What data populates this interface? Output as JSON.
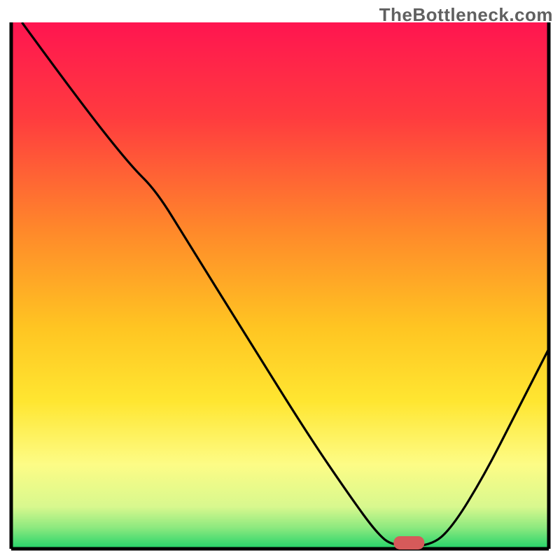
{
  "watermark": "TheBottleneck.com",
  "chart_data": {
    "type": "line",
    "title": "",
    "xlabel": "",
    "ylabel": "",
    "xlim": [
      0,
      100
    ],
    "ylim": [
      0,
      100
    ],
    "notes": "Gradient bottleneck heat chart with a black V-shaped curve; minimum between x≈70 and x≈78 (green zone). Red marker sits on the green band at the curve minimum.",
    "gradient_stops": [
      {
        "pct": 0,
        "color": "#ff1550"
      },
      {
        "pct": 18,
        "color": "#ff3b3f"
      },
      {
        "pct": 40,
        "color": "#ff8a2a"
      },
      {
        "pct": 58,
        "color": "#ffc522"
      },
      {
        "pct": 72,
        "color": "#ffe631"
      },
      {
        "pct": 84,
        "color": "#fdfc86"
      },
      {
        "pct": 92,
        "color": "#d8f88e"
      },
      {
        "pct": 96,
        "color": "#8ce97f"
      },
      {
        "pct": 100,
        "color": "#22d36a"
      }
    ],
    "curve_points": [
      {
        "x": 2,
        "y": 100
      },
      {
        "x": 12,
        "y": 86
      },
      {
        "x": 22,
        "y": 73
      },
      {
        "x": 27,
        "y": 68
      },
      {
        "x": 33,
        "y": 58
      },
      {
        "x": 44,
        "y": 40
      },
      {
        "x": 55,
        "y": 22
      },
      {
        "x": 63,
        "y": 10
      },
      {
        "x": 68,
        "y": 3
      },
      {
        "x": 71,
        "y": 0.5
      },
      {
        "x": 78,
        "y": 0.5
      },
      {
        "x": 82,
        "y": 4
      },
      {
        "x": 88,
        "y": 14
      },
      {
        "x": 94,
        "y": 26
      },
      {
        "x": 100,
        "y": 38
      }
    ],
    "marker": {
      "x": 74,
      "y": 1.2,
      "color": "#d65a5a"
    }
  }
}
